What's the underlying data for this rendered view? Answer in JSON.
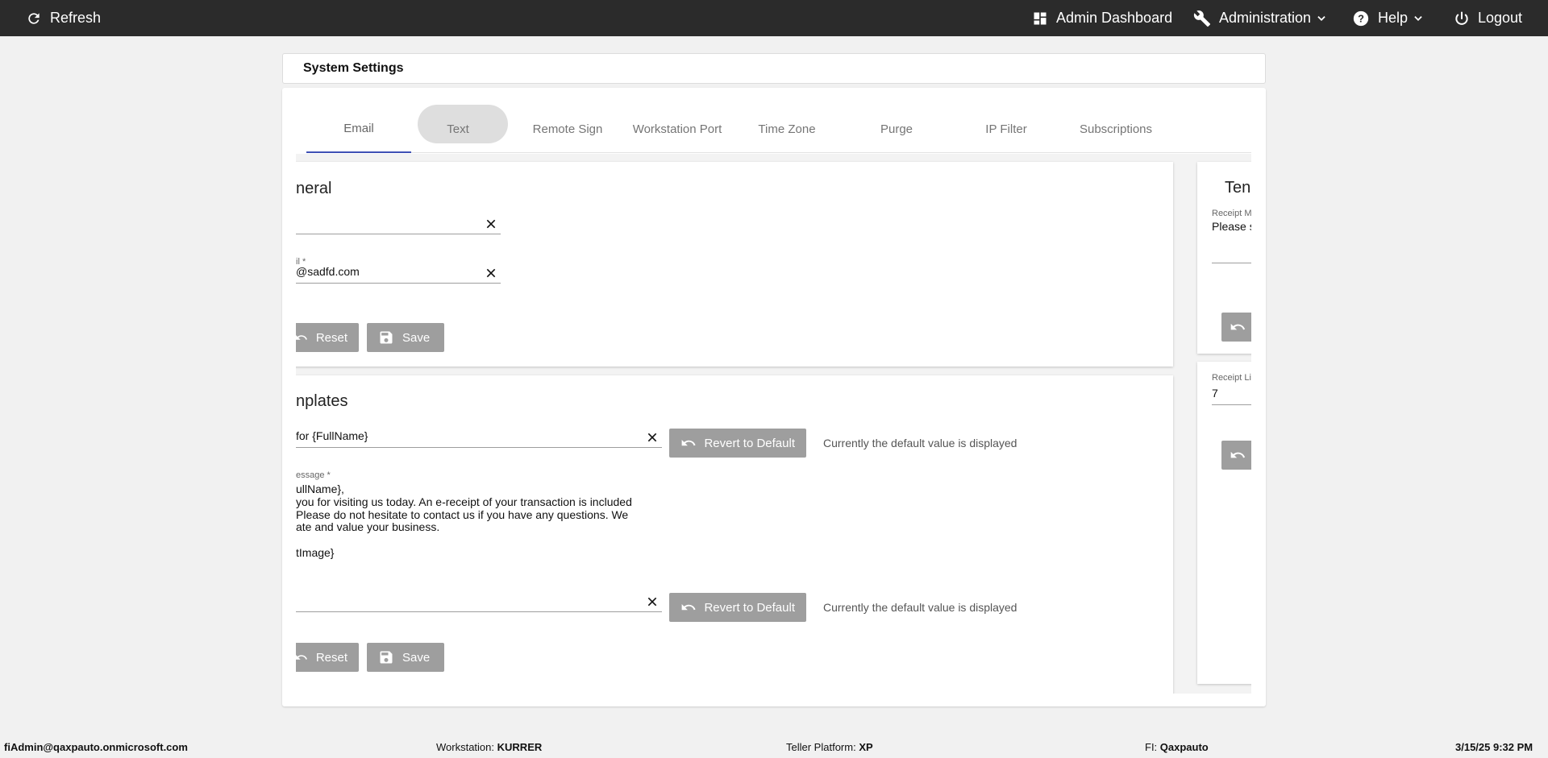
{
  "topbar": {
    "refresh": "Refresh",
    "admin_dashboard": "Admin Dashboard",
    "administration": "Administration",
    "help": "Help",
    "logout": "Logout"
  },
  "page_title": "System Settings",
  "tabs": [
    {
      "label": "Email",
      "active": true
    },
    {
      "label": "Text",
      "active": false
    },
    {
      "label": "Remote Sign",
      "active": false
    },
    {
      "label": "Workstation Port",
      "active": false
    },
    {
      "label": "Time Zone",
      "active": false
    },
    {
      "label": "Purge",
      "active": false
    },
    {
      "label": "IP Filter",
      "active": false
    },
    {
      "label": "Subscriptions",
      "active": false
    }
  ],
  "general": {
    "title": "neral",
    "field1_value": "",
    "field2_label": "il *",
    "field2_value": "@sadfd.com",
    "reset_label": "Reset",
    "save_label": "Save"
  },
  "templates": {
    "title": "nplates",
    "subject_value": " for {FullName}",
    "revert_label": "Revert to Default",
    "default_note": "Currently the default value is displayed",
    "message_label": "essage *",
    "message_lines": [
      "ullName},",
      "you for visiting us today. An e-receipt of your transaction is included",
      "Please do not hesitate to contact us if you have any questions. We",
      "ate and value your business.",
      "",
      "tImage}"
    ],
    "footer_value": "",
    "revert2_label": "Revert to Default",
    "default_note2": "Currently the default value is displayed",
    "reset_label": "Reset",
    "save_label": "Save"
  },
  "right_panel": {
    "title": "Ten",
    "field_label": "Receipt M",
    "field_value": "Please s",
    "field2_label": "Receipt Li",
    "field2_value": "7"
  },
  "statusbar": {
    "user": "fiAdmin@qaxpauto.onmicrosoft.com",
    "workstation_label": "Workstation:",
    "workstation_value": "KURRER",
    "platform_label": "Teller Platform:",
    "platform_value": "XP",
    "fi_label": "FI:",
    "fi_value": "Qaxpauto",
    "datetime": "3/15/25 9:32 PM"
  },
  "colors": {
    "topbar": "#2b2b2b",
    "active_tab": "#3f51b5",
    "button": "#9e9e9e"
  }
}
